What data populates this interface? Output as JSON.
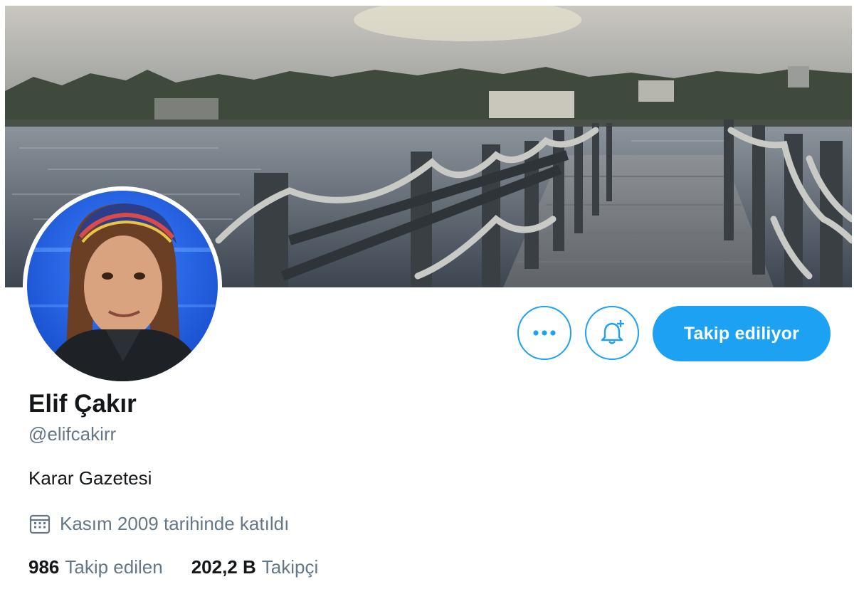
{
  "profile": {
    "name": "Elif Çakır",
    "handle": "@elifcakirr",
    "bio": "Karar Gazetesi",
    "joined": "Kasım 2009 tarihinde katıldı"
  },
  "actions": {
    "more_icon": "more-icon",
    "bell_icon": "bell-plus-icon",
    "follow_label": "Takip ediliyor"
  },
  "stats": {
    "following_count": "986",
    "following_label": "Takip edilen",
    "followers_count": "202,2 B",
    "followers_label": "Takipçi"
  },
  "colors": {
    "accent": "#1da1f2",
    "text_primary": "#14171a",
    "text_secondary": "#657786"
  }
}
